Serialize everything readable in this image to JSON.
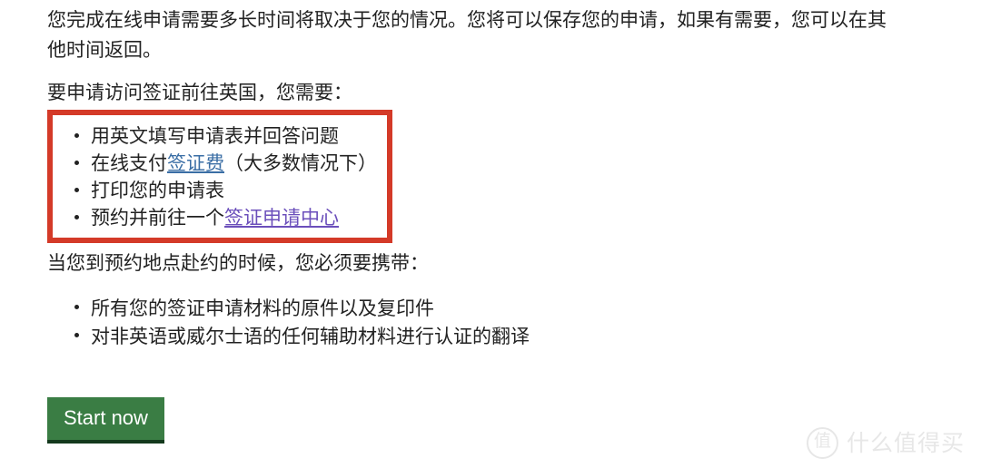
{
  "page": {
    "background_color": "#ffffff",
    "text_color": "#222222"
  },
  "content": {
    "intro_paragraph": "您完成在线申请需要多长时间将取决于您的情况。您将可以保存您的申请，如果有需要，您可以在其他时间返回。",
    "requirements_heading": "要申请访问签证前往英国，您需要：",
    "bring_heading": "当您到预约地点赴约的时候，您必须要携带："
  },
  "highlight_box": {
    "border_color": "#d43a28",
    "border_width_px": 6
  },
  "requirements_list": {
    "items": [
      {
        "prefix": "用英文填写申请表并回答问题",
        "link": "",
        "suffix": ""
      },
      {
        "prefix": "在线支付",
        "link": "签证费",
        "link_color": "#3a6ea5",
        "suffix": "（大多数情况下）"
      },
      {
        "prefix": "打印您的申请表",
        "link": "",
        "suffix": ""
      },
      {
        "prefix": "预约并前往一个",
        "link": "签证申请中心",
        "link_color": "#6b4fbb",
        "suffix": ""
      }
    ]
  },
  "bring_list": {
    "items": [
      "所有您的签证申请材料的原件以及复印件",
      "对非英语或威尔士语的任何辅助材料进行认证的翻译"
    ]
  },
  "start_button": {
    "label": "Start now",
    "background_color": "#3a7d44",
    "text_color": "#ffffff",
    "bottom_border_color": "#13391c"
  },
  "watermark": {
    "badge_text": "值",
    "text": "什么值得买",
    "color": "#e7e7e7"
  }
}
